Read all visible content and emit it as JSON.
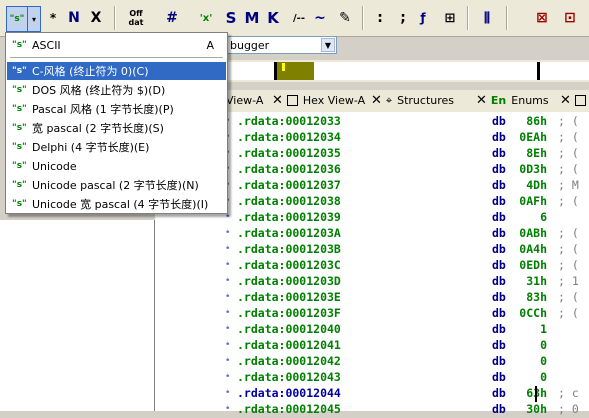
{
  "toolbar": {
    "buttons": [
      {
        "name": "string-type-dropdown",
        "label": "\"s\"",
        "icon": "string-icon"
      },
      {
        "name": "star-button",
        "label": "*",
        "icon": "asterisk-icon"
      },
      {
        "name": "name-button",
        "label": "N",
        "icon": "name-icon"
      },
      {
        "name": "undefine-button",
        "label": "X",
        "icon": "close-icon"
      },
      {
        "name": "offset-button",
        "label": "Off dat",
        "icon": "offset-icon"
      },
      {
        "name": "number-button",
        "label": "#",
        "icon": "hash-icon"
      },
      {
        "name": "char-button",
        "label": "'x'",
        "icon": "char-icon"
      },
      {
        "name": "string-s-button",
        "label": "S",
        "icon": "segment-icon"
      },
      {
        "name": "make-button",
        "label": "M",
        "icon": "struct-icon"
      },
      {
        "name": "k-button",
        "label": "K",
        "icon": "stackvar-icon"
      },
      {
        "name": "comment-slash-button",
        "label": "/--",
        "icon": "comment-icon"
      },
      {
        "name": "tilde-button",
        "label": "~",
        "icon": "bitwise-not-icon"
      },
      {
        "name": "pen-button",
        "label": "✎",
        "icon": "pencil-icon"
      },
      {
        "name": "colon-button",
        "label": ":",
        "icon": "colon-icon"
      },
      {
        "name": "semicolon-button",
        "label": ";",
        "icon": "semicolon-icon"
      },
      {
        "name": "func-button",
        "label": "ƒ",
        "icon": "function-icon"
      },
      {
        "name": "graph-button",
        "label": "⊞",
        "icon": "graph-icon"
      },
      {
        "name": "chart-button",
        "label": "⫼",
        "icon": "chart-icon"
      },
      {
        "name": "grid-button",
        "label": "⊠",
        "icon": "grid-icon"
      },
      {
        "name": "xref-button",
        "label": "⊡",
        "icon": "xref-icon"
      }
    ]
  },
  "debugger": {
    "value": "bugger"
  },
  "tabs": [
    {
      "label": "View-A"
    },
    {
      "label": "Hex View-A"
    },
    {
      "label": "Structures"
    },
    {
      "label": "Enums",
      "prefix": "En"
    }
  ],
  "menu": {
    "items": [
      {
        "label": "ASCII",
        "accel": "A",
        "icon": "\"s\""
      },
      {
        "label": "C-风格 (终止符为 0)(C)",
        "icon": "\"s\"",
        "selected": true
      },
      {
        "label": "DOS 风格 (终止符为 $)(D)",
        "icon": "\"s\""
      },
      {
        "label": "Pascal 风格 (1 字节长度)(P)",
        "icon": "\"s\""
      },
      {
        "label": "宽 pascal (2 字节长度)(S)",
        "icon": "\"s\""
      },
      {
        "label": "Delphi (4 字节长度)(E)",
        "icon": "\"s\""
      },
      {
        "label": "Unicode",
        "icon": "\"s\""
      },
      {
        "label": "Unicode pascal (2 字节长度)(N)",
        "icon": "\"s\""
      },
      {
        "label": "Unicode 宽 pascal (4 字节长度)(I)",
        "icon": "\"s\""
      }
    ]
  },
  "disasm": {
    "rows": [
      {
        "addr": ".rdata:00012033",
        "op": "db",
        "val": "86h",
        "cmt": "; ("
      },
      {
        "addr": ".rdata:00012034",
        "op": "db",
        "val": "0EAh",
        "cmt": "; ("
      },
      {
        "addr": ".rdata:00012035",
        "op": "db",
        "val": "8Eh",
        "cmt": "; ("
      },
      {
        "addr": ".rdata:00012036",
        "op": "db",
        "val": "0D3h",
        "cmt": "; ("
      },
      {
        "addr": ".rdata:00012037",
        "op": "db",
        "val": "4Dh",
        "cmt": "; M"
      },
      {
        "addr": ".rdata:00012038",
        "op": "db",
        "val": "0AFh",
        "cmt": "; ("
      },
      {
        "addr": ".rdata:00012039",
        "op": "db",
        "val": "6",
        "cmt": ""
      },
      {
        "addr": ".rdata:0001203A",
        "op": "db",
        "val": "0ABh",
        "cmt": "; ("
      },
      {
        "addr": ".rdata:0001203B",
        "op": "db",
        "val": "0A4h",
        "cmt": "; ("
      },
      {
        "addr": ".rdata:0001203C",
        "op": "db",
        "val": "0EDh",
        "cmt": "; ("
      },
      {
        "addr": ".rdata:0001203D",
        "op": "db",
        "val": "31h",
        "cmt": "; 1"
      },
      {
        "addr": ".rdata:0001203E",
        "op": "db",
        "val": "83h",
        "cmt": "; ("
      },
      {
        "addr": ".rdata:0001203F",
        "op": "db",
        "val": "0CCh",
        "cmt": "; ("
      },
      {
        "addr": ".rdata:00012040",
        "op": "db",
        "val": "1",
        "cmt": ""
      },
      {
        "addr": ".rdata:00012041",
        "op": "db",
        "val": "0",
        "cmt": ""
      },
      {
        "addr": ".rdata:00012042",
        "op": "db",
        "val": "0",
        "cmt": ""
      },
      {
        "addr": ".rdata:00012043",
        "op": "db",
        "val": "0",
        "cmt": ""
      },
      {
        "addr": ".rdata:00012044",
        "op": "db",
        "val": "63h",
        "cmt": "; c",
        "current": true
      },
      {
        "addr": ".rdata:00012045",
        "op": "db",
        "val": "30h",
        "cmt": "; 0"
      }
    ]
  }
}
